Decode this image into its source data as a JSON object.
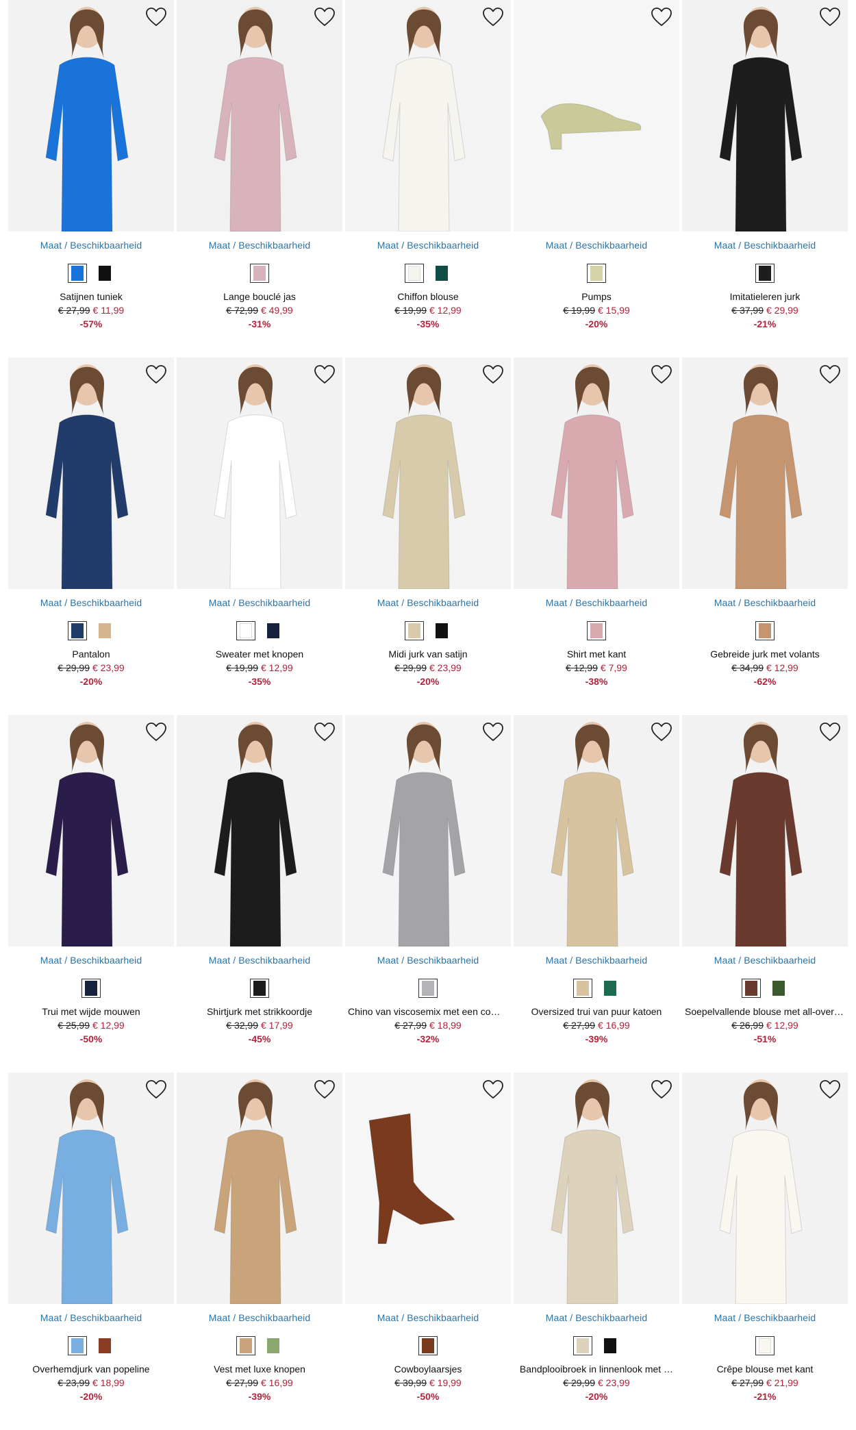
{
  "availability_label": "Maat / Beschikbaarheid",
  "products": [
    {
      "name": "Satijnen tuniek",
      "old": "€ 27,99",
      "new": "€ 11,99",
      "disc": "-57%",
      "bg": "#f2f2f2",
      "color": "#1a73d8",
      "swatches": [
        "#1a73d8",
        "#111111"
      ]
    },
    {
      "name": "Lange bouclé jas",
      "old": "€ 72,99",
      "new": "€ 49,99",
      "disc": "-31%",
      "bg": "#f1f1f1",
      "color": "#d9b3bb",
      "swatches": [
        "#d9b3bb"
      ]
    },
    {
      "name": "Chiffon blouse",
      "old": "€ 19,99",
      "new": "€ 12,99",
      "disc": "-35%",
      "bg": "#f3f3f3",
      "color": "#f6f4ee",
      "swatches": [
        "#f6f4ee",
        "#124c46"
      ]
    },
    {
      "name": "Pumps",
      "old": "€ 19,99",
      "new": "€ 15,99",
      "disc": "-20%",
      "bg": "#f6f6f6",
      "color": "#c9c99a",
      "swatches": [
        "#d4d3a8"
      ]
    },
    {
      "name": "Imitatieleren jurk",
      "old": "€ 37,99",
      "new": "€ 29,99",
      "disc": "-21%",
      "bg": "#f2f2f2",
      "color": "#1d1d1d",
      "swatches": [
        "#1d1d1d"
      ]
    },
    {
      "name": "Pantalon",
      "old": "€ 29,99",
      "new": "€ 23,99",
      "disc": "-20%",
      "bg": "#f3f3f3",
      "color": "#213b6b",
      "swatches": [
        "#213b6b",
        "#d4b48c"
      ]
    },
    {
      "name": "Sweater met knopen",
      "old": "€ 19,99",
      "new": "€ 12,99",
      "disc": "-35%",
      "bg": "#f2f2f2",
      "color": "#ffffff",
      "swatches": [
        "#ffffff",
        "#17223f"
      ]
    },
    {
      "name": "Midi jurk van satijn",
      "old": "€ 29,99",
      "new": "€ 23,99",
      "disc": "-20%",
      "bg": "#f3f3f3",
      "color": "#d8cbac",
      "swatches": [
        "#d8cbac",
        "#111111"
      ]
    },
    {
      "name": "Shirt met kant",
      "old": "€ 12,99",
      "new": "€ 7,99",
      "disc": "-38%",
      "bg": "#f2f2f2",
      "color": "#d9a9b0",
      "swatches": [
        "#d9a9b0"
      ]
    },
    {
      "name": "Gebreide jurk met volants",
      "old": "€ 34,99",
      "new": "€ 12,99",
      "disc": "-62%",
      "bg": "#f2f2f2",
      "color": "#c4956f",
      "swatches": [
        "#c4956f"
      ]
    },
    {
      "name": "Trui met wijde mouwen",
      "old": "€ 25,99",
      "new": "€ 12,99",
      "disc": "-50%",
      "bg": "#f3f3f3",
      "color": "#2a1d4a",
      "swatches": [
        "#17223f"
      ]
    },
    {
      "name": "Shirtjurk met strikkoordje",
      "old": "€ 32,99",
      "new": "€ 17,99",
      "disc": "-45%",
      "bg": "#f2f2f2",
      "color": "#1c1c1c",
      "swatches": [
        "#1c1c1c"
      ]
    },
    {
      "name": "Chino van viscosemix met een comf…",
      "old": "€ 27,99",
      "new": "€ 18,99",
      "disc": "-32%",
      "bg": "#f4f4f4",
      "color": "#a4a4a8",
      "swatches": [
        "#b4b4b8"
      ]
    },
    {
      "name": "Oversized trui van puur katoen",
      "old": "€ 27,99",
      "new": "€ 16,99",
      "disc": "-39%",
      "bg": "#f2f2f2",
      "color": "#d8c3a0",
      "swatches": [
        "#d8c3a0",
        "#1d6b4e"
      ]
    },
    {
      "name": "Soepelvallende blouse met all-over …",
      "old": "€ 26,99",
      "new": "€ 12,99",
      "disc": "-51%",
      "bg": "#f2f2f2",
      "color": "#6b3a2e",
      "swatches": [
        "#6b3a2e",
        "#3b5a2e"
      ]
    },
    {
      "name": "Overhemdjurk van popeline",
      "old": "€ 23,99",
      "new": "€ 18,99",
      "disc": "-20%",
      "bg": "#f2f2f2",
      "color": "#78aee0",
      "swatches": [
        "#78aee0",
        "#8a3b22"
      ]
    },
    {
      "name": "Vest met luxe knopen",
      "old": "€ 27,99",
      "new": "€ 16,99",
      "disc": "-39%",
      "bg": "#f2f2f2",
      "color": "#c9a47a",
      "swatches": [
        "#c9a47a",
        "#8aa86e"
      ]
    },
    {
      "name": "Cowboylaarsjes",
      "old": "€ 39,99",
      "new": "€ 19,99",
      "disc": "-50%",
      "bg": "#f6f6f6",
      "color": "#7a3a1e",
      "swatches": [
        "#7a3a1e"
      ]
    },
    {
      "name": "Bandplooibroek in linnenlook met …",
      "old": "€ 29,99",
      "new": "€ 23,99",
      "disc": "-20%",
      "bg": "#f3f3f3",
      "color": "#ddd2bb",
      "swatches": [
        "#ddd2bb",
        "#111111"
      ]
    },
    {
      "name": "Crêpe blouse met kant",
      "old": "€ 27,99",
      "new": "€ 21,99",
      "disc": "-21%",
      "bg": "#f2f2f2",
      "color": "#faf7f0",
      "swatches": [
        "#faf7f0"
      ]
    }
  ]
}
